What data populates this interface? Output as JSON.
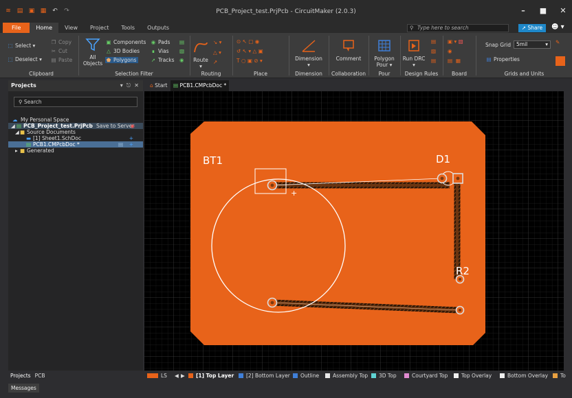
{
  "window": {
    "title": "PCB_Project_test.PrjPcb - CircuitMaker (2.0.3)"
  },
  "tabs": [
    "File",
    "Home",
    "View",
    "Project",
    "Tools",
    "Outputs"
  ],
  "search": {
    "placeholder": "Type here to search"
  },
  "share_label": "Share",
  "ribbon": {
    "clipboard": {
      "label": "Clipboard",
      "select": "Select",
      "deselect": "Deselect",
      "copy": "Copy",
      "cut": "Cut",
      "paste": "Paste"
    },
    "selection_filter": {
      "label": "Selection Filter",
      "all_objects": "All Objects",
      "components": "Components",
      "bodies": "3D Bodies",
      "polygons": "Polygons",
      "pads": "Pads",
      "vias": "Vias",
      "tracks": "Tracks"
    },
    "routing": {
      "label": "Routing",
      "route": "Route"
    },
    "place": {
      "label": "Place"
    },
    "dimension": {
      "label": "Dimension",
      "button": "Dimension"
    },
    "collaboration": {
      "label": "Collaboration",
      "button": "Comment"
    },
    "pour": {
      "label": "Pour",
      "button": "Polygon Pour"
    },
    "design_rules": {
      "label": "Design Rules",
      "button": "Run DRC"
    },
    "board": {
      "label": "Board"
    },
    "grids": {
      "label": "Grids and Units",
      "snap_label": "Snap Grid",
      "snap_value": "5mil",
      "properties": "Properties"
    }
  },
  "projects_panel": {
    "title": "Projects",
    "search_label": "Search",
    "items": [
      {
        "label": "My Personal Space"
      },
      {
        "label": "PCB_Project_test.PrjPcb",
        "status": "Save to Server"
      },
      {
        "label": "Source Documents"
      },
      {
        "label": "[1] Sheet1.SchDoc"
      },
      {
        "label": "PCB1.CMPcbDoc *"
      },
      {
        "label": "Generated"
      }
    ]
  },
  "bottom_tabs": [
    "Projects",
    "PCB"
  ],
  "messages_label": "Messages",
  "doc_tabs": [
    "Start",
    "PCB1.CMPcbDoc *"
  ],
  "pcb": {
    "designators": [
      "BT1",
      "D1",
      "R2"
    ]
  },
  "layers": [
    {
      "label": "LS",
      "color": "#e8631a"
    },
    {
      "label": "[1] Top Layer",
      "color": "#e8631a",
      "active": true
    },
    {
      "label": "[2] Bottom Layer",
      "color": "#3f7fd8"
    },
    {
      "label": "Outline",
      "color": "#3f7fd8"
    },
    {
      "label": "Assembly Top",
      "color": "#e8e8e8"
    },
    {
      "label": "3D Top",
      "color": "#5fd3d3"
    },
    {
      "label": "Courtyard Top",
      "color": "#e08ad0"
    },
    {
      "label": "Top Overlay",
      "color": "#f0f0f0"
    },
    {
      "label": "Bottom Overlay",
      "color": "#f0f0f0"
    },
    {
      "label": "To",
      "color": "#e8a040"
    }
  ]
}
